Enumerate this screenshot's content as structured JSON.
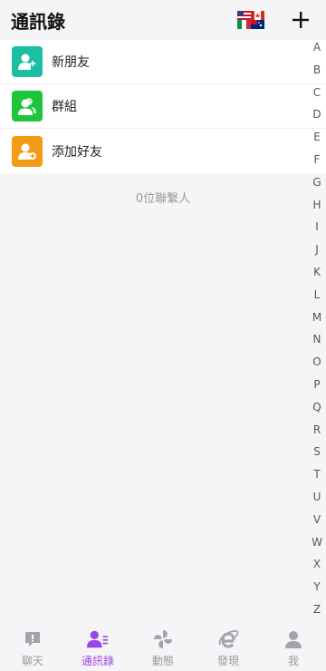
{
  "header": {
    "title": "通訊錄"
  },
  "menu": {
    "items": [
      {
        "label": "新朋友",
        "icon": "new-friend-icon",
        "color": "#1dbfa3"
      },
      {
        "label": "群組",
        "icon": "group-icon",
        "color": "#1ec43a"
      },
      {
        "label": "添加好友",
        "icon": "add-friend-icon",
        "color": "#f39a16"
      }
    ]
  },
  "contacts": {
    "count_text": "0位聯繫人"
  },
  "index": {
    "letters": [
      "A",
      "B",
      "C",
      "D",
      "E",
      "F",
      "G",
      "H",
      "I",
      "J",
      "K",
      "L",
      "M",
      "N",
      "O",
      "P",
      "Q",
      "R",
      "S",
      "T",
      "U",
      "V",
      "W",
      "X",
      "Y",
      "Z"
    ]
  },
  "tabs": {
    "items": [
      {
        "label": "聊天",
        "icon": "chat-icon",
        "active": false
      },
      {
        "label": "通訊錄",
        "icon": "contacts-icon",
        "active": true
      },
      {
        "label": "動態",
        "icon": "moments-icon",
        "active": false
      },
      {
        "label": "發現",
        "icon": "discover-icon",
        "active": false
      },
      {
        "label": "我",
        "icon": "me-icon",
        "active": false
      }
    ]
  },
  "colors": {
    "accent": "#9b45e4",
    "inactive": "#a0a4ab",
    "background": "#f5f5f7"
  }
}
